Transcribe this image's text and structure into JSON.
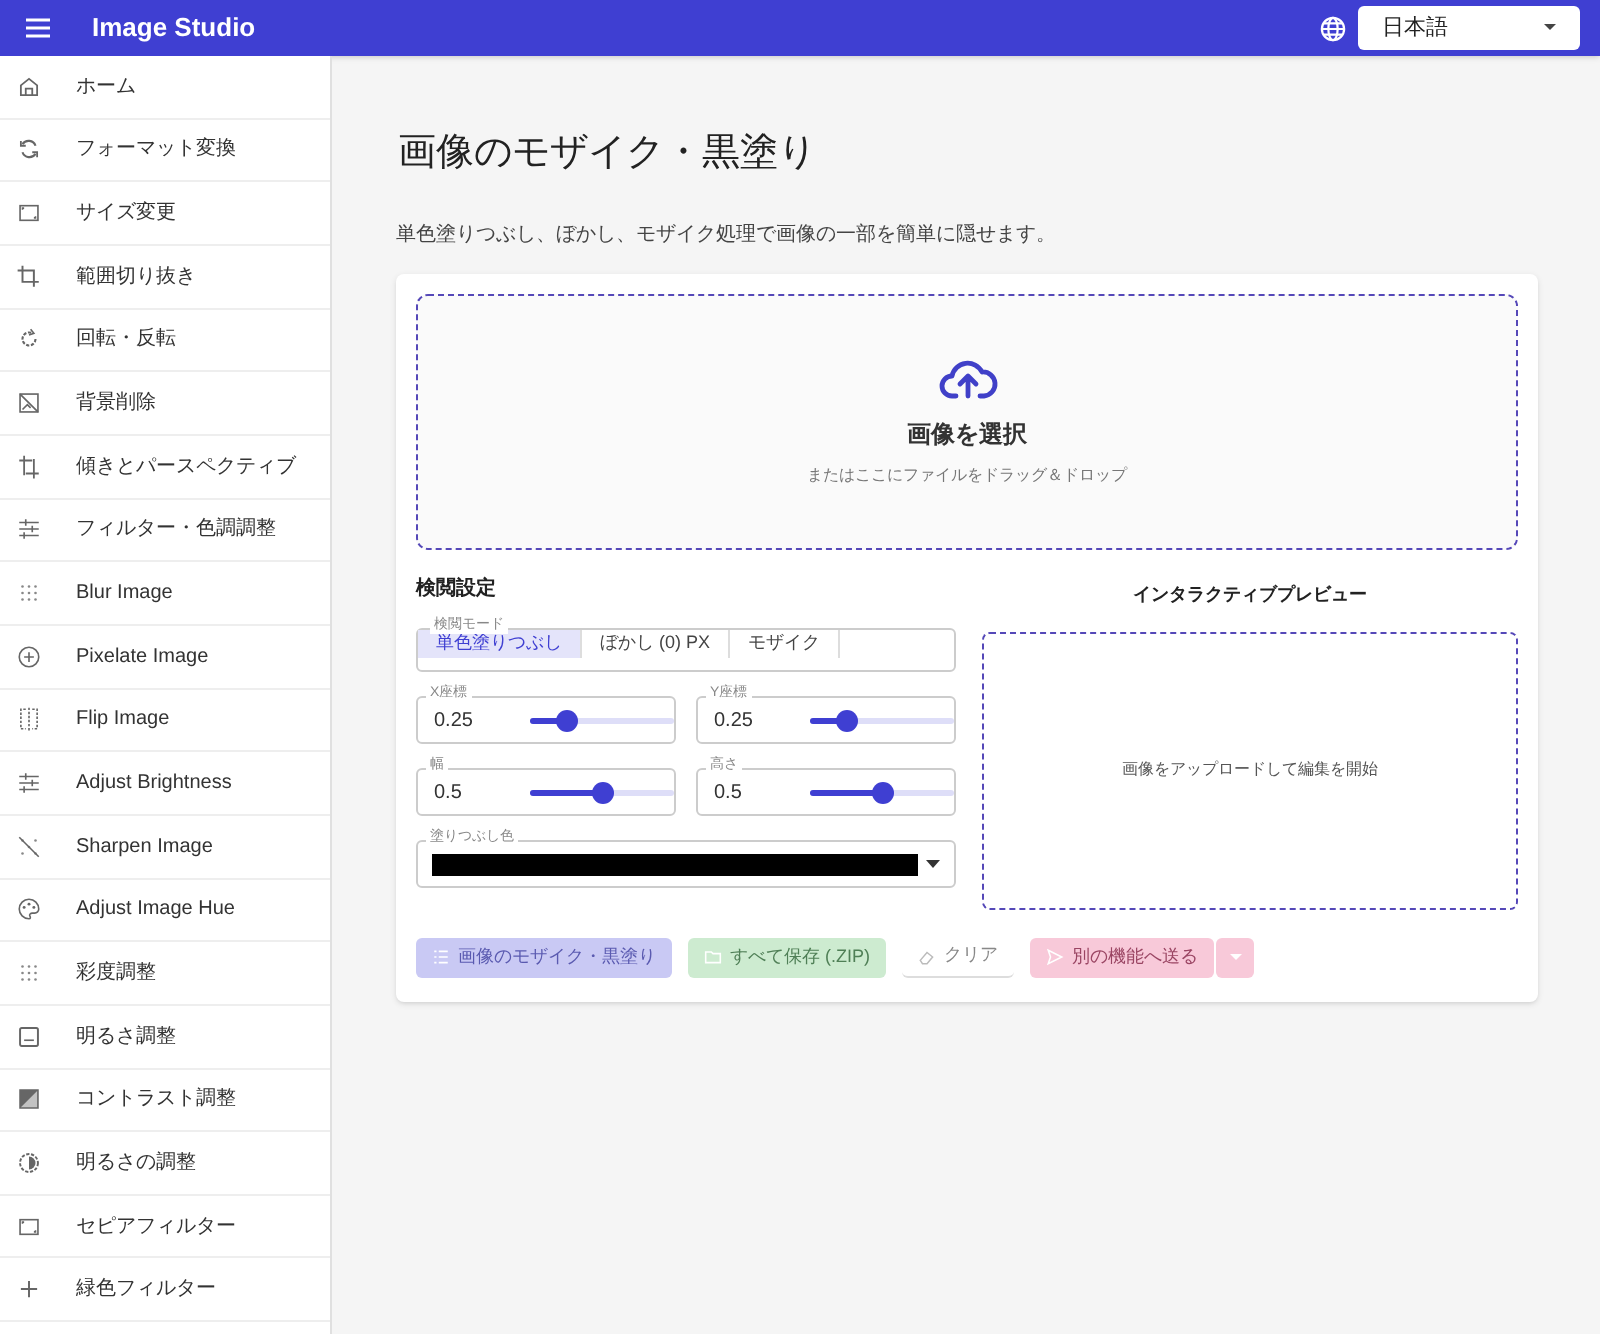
{
  "app_bar": {
    "title": "Image Studio",
    "language": "日本語"
  },
  "sidebar": {
    "items": [
      {
        "label": "ホーム",
        "selected": false
      },
      {
        "label": "フォーマット変換",
        "selected": false
      },
      {
        "label": "サイズ変更",
        "selected": false
      },
      {
        "label": "範囲切り抜き",
        "selected": false
      },
      {
        "label": "回転・反転",
        "selected": false
      },
      {
        "label": "背景削除",
        "selected": false
      },
      {
        "label": "傾きとパースペクティブ",
        "selected": false
      },
      {
        "label": "フィルター・色調調整",
        "selected": false
      },
      {
        "label": "Blur Image",
        "selected": false
      },
      {
        "label": "Pixelate Image",
        "selected": false
      },
      {
        "label": "Flip Image",
        "selected": false
      },
      {
        "label": "Adjust Brightness",
        "selected": false
      },
      {
        "label": "Sharpen Image",
        "selected": false
      },
      {
        "label": "Adjust Image Hue",
        "selected": false
      },
      {
        "label": "彩度調整",
        "selected": false
      },
      {
        "label": "明るさ調整",
        "selected": false
      },
      {
        "label": "コントラスト調整",
        "selected": false
      },
      {
        "label": "明るさの調整",
        "selected": false
      },
      {
        "label": "セピアフィルター",
        "selected": false
      },
      {
        "label": "緑色フィルター",
        "selected": false
      }
    ]
  },
  "page": {
    "title": "画像のモザイク・黒塗り",
    "description": "単色塗りつぶし、ぼかし、モザイク処理で画像の一部を簡単に隠せます。"
  },
  "dropzone": {
    "title": "画像を選択",
    "hint": "またはここにファイルをドラッグ＆ドロップ"
  },
  "settings": {
    "title": "検閲設定",
    "mode_label": "検閲モード",
    "modes": [
      {
        "label": "単色塗りつぶし",
        "selected": true
      },
      {
        "label": "ぼかし (0) PX",
        "selected": false
      },
      {
        "label": "モザイク",
        "selected": false
      }
    ],
    "sliders": [
      {
        "label": "X座標",
        "value": "0.25",
        "level": 0.25
      },
      {
        "label": "Y座標",
        "value": "0.25",
        "level": 0.25
      },
      {
        "label": "幅",
        "value": "0.5",
        "level": 0.5
      },
      {
        "label": "高さ",
        "value": "0.5",
        "level": 0.5
      }
    ],
    "fill_color": {
      "label": "塗りつぶし色",
      "color": "#000000"
    }
  },
  "preview": {
    "title": "インタラクティブプレビュー",
    "placeholder": "画像をアップロードして編集を開始"
  },
  "actions": [
    {
      "kind": "apply",
      "label": "画像のモザイク・黒塗り",
      "disabled": true
    },
    {
      "kind": "save",
      "label": "すべて保存 (.ZIP)",
      "disabled": true
    },
    {
      "kind": "clear",
      "label": "クリア",
      "disabled": true
    },
    {
      "kind": "send",
      "label": "別の機能へ送る",
      "disabled": true
    }
  ]
}
